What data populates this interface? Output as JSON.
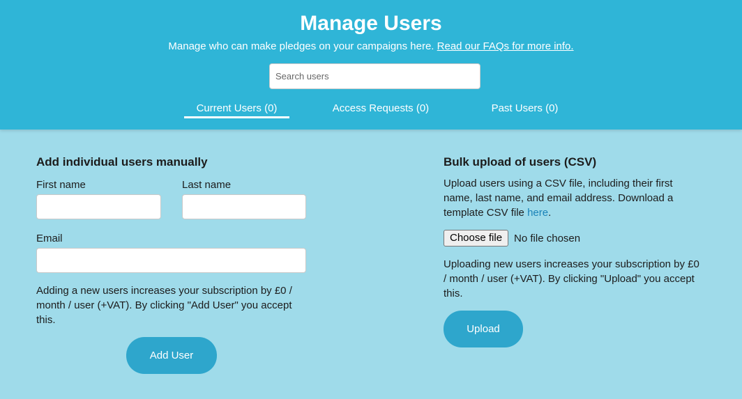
{
  "header": {
    "title": "Manage Users",
    "subtitle": "Manage who can make pledges on your campaigns here.",
    "faq_link": "Read our FAQs for more info.",
    "search": {
      "placeholder": "Search users",
      "value": ""
    },
    "tabs": [
      {
        "label": "Current Users (0)",
        "active": true
      },
      {
        "label": "Access Requests (0)",
        "active": false
      },
      {
        "label": "Past Users (0)",
        "active": false
      }
    ]
  },
  "manual": {
    "heading": "Add individual users manually",
    "first_name_label": "First name",
    "last_name_label": "Last name",
    "email_label": "Email",
    "first_name_value": "",
    "last_name_value": "",
    "email_value": "",
    "notice": "Adding a new users increases your subscription by £0 / month / user (+VAT). By clicking \"Add User\" you accept this.",
    "add_button": "Add User"
  },
  "bulk": {
    "heading": "Bulk upload of users (CSV)",
    "description": "Upload users using a CSV file, including their first name, last name, and email address. Download a template CSV file",
    "here_link": "here",
    "description_end": ".",
    "choose_file": "Choose file",
    "file_status": "No file chosen",
    "notice": "Uploading new users increases your subscription by £0 / month / user (+VAT). By clicking \"Upload\" you accept this.",
    "upload_button": "Upload"
  },
  "colors": {
    "header_bg": "#2fb5d7",
    "body_bg": "#9fdbea",
    "button_bg": "#2ea6cc",
    "link": "#1a83b8"
  }
}
